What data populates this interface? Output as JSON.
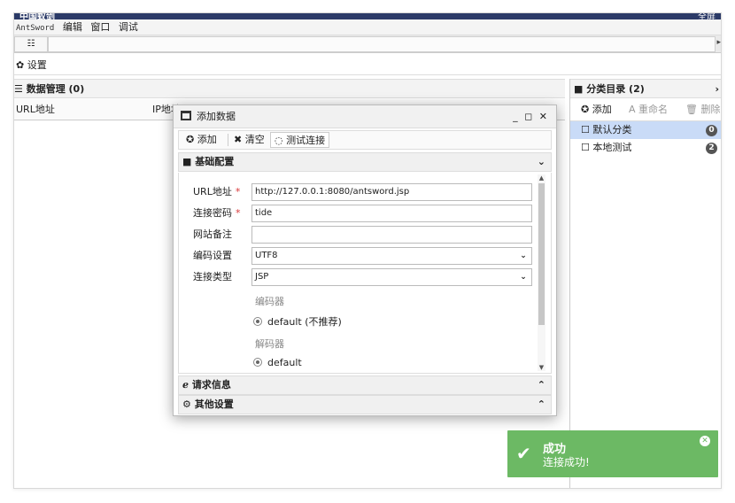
{
  "window": {
    "title": "中国蚁剑",
    "right_text": "全屏"
  },
  "menu": {
    "app_name": "AntSword",
    "items": [
      "编辑",
      "窗口",
      "调试"
    ]
  },
  "tabs": {
    "grid_glyph": "☷",
    "arrow_glyph": "▸"
  },
  "settings": {
    "label": "✿ 设置"
  },
  "data_manager": {
    "title": "☰ 数据管理 (0)",
    "columns": [
      "URL地址",
      "IP地址"
    ]
  },
  "category": {
    "title": "■ 分类目录 (2)",
    "chevron": "›",
    "toolbar": {
      "add": "✪ 添加",
      "rename": "A 重命名",
      "delete": "🗑 删除"
    },
    "items": [
      {
        "name": "☐ 默认分类",
        "count": "0"
      },
      {
        "name": "☐ 本地测试",
        "count": "2"
      }
    ]
  },
  "dialog": {
    "title": "添加数据",
    "controls": "_ ◻ ✕",
    "toolbar": {
      "add": "✪ 添加",
      "clear": "✖ 清空",
      "test": "◌ 测试连接"
    },
    "section_basic": "■ 基础配置",
    "section_request": "ℯ 请求信息",
    "section_other": "⚙ 其他设置",
    "chev_down": "⌄",
    "chev_up": "⌃",
    "fields": {
      "url_label": "URL地址",
      "url_value": "http://127.0.0.1:8080/antsword.jsp",
      "pwd_label": "连接密码",
      "pwd_value": "tide",
      "note_label": "网站备注",
      "note_value": "",
      "encoding_label": "编码设置",
      "encoding_value": "UTF8",
      "type_label": "连接类型",
      "type_value": "JSP",
      "required_mark": "*",
      "encoder_label": "编码器",
      "encoder_option": "default (不推荐)",
      "decoder_label": "解码器",
      "decoder_option": "default"
    }
  },
  "toast": {
    "title": "成功",
    "message": "连接成功!",
    "check": "✔",
    "close": "✕",
    "color": "#6cb964"
  }
}
